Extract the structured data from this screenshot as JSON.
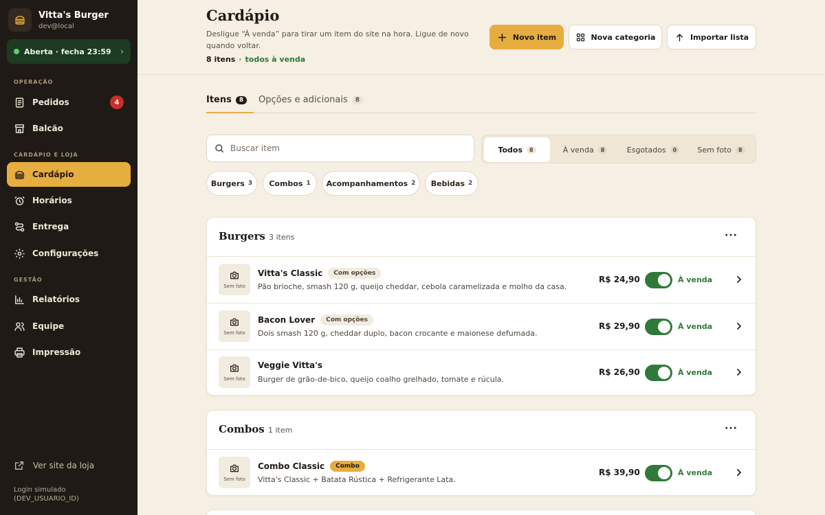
{
  "brand": {
    "name": "Vitta's Burger",
    "user": "dev@local"
  },
  "status": {
    "text": "Aberta · fecha 23:59"
  },
  "nav": {
    "section_operacao": "OPERAÇÃO",
    "section_cardapio": "CARDÁPIO E LOJA",
    "section_gestao": "GESTÃO",
    "pedidos": "Pedidos",
    "pedidos_badge": "4",
    "balcao": "Balcão",
    "cardapio": "Cardápio",
    "horarios": "Horários",
    "entrega": "Entrega",
    "configuracoes": "Configurações",
    "relatorios": "Relatórios",
    "equipe": "Equipe",
    "impressao": "Impressão",
    "ver_site": "Ver site da loja",
    "login_line1": "Login simulado",
    "login_line2": "(DEV_USUARIO_ID)"
  },
  "header": {
    "title": "Cardápio",
    "subtitle": "Desligue “À venda” para tirar um item do site na hora. Ligue de novo quando voltar.",
    "count": "8 itens",
    "separator": "·",
    "count_status": "todos à venda",
    "btn_new": "Novo item",
    "btn_category": "Nova categoria",
    "btn_import": "Importar lista"
  },
  "tabs": {
    "items_label": "Itens",
    "items_count": "8",
    "options_label": "Opções e adicionais",
    "options_count": "8"
  },
  "search": {
    "placeholder": "Buscar item"
  },
  "filters": {
    "all": "Todos",
    "all_count": "8",
    "sale": "À venda",
    "sale_count": "8",
    "sold": "Esgotados",
    "sold_count": "0",
    "nophoto": "Sem foto",
    "nophoto_count": "8"
  },
  "chips": {
    "burgers": "Burgers",
    "burgers_count": "3",
    "combos": "Combos",
    "combos_count": "1",
    "acomp": "Acompanhamentos",
    "acomp_count": "2",
    "bebidas": "Bebidas",
    "bebidas_count": "2"
  },
  "thumb_label": "Sem foto",
  "availability_label": "À venda",
  "sections": [
    {
      "title": "Burgers",
      "count": "3 itens",
      "items": [
        {
          "name": "Vitta's Classic",
          "tag": "Com opções",
          "desc": "Pão brioche, smash 120 g, queijo cheddar, cebola caramelizada e molho da casa.",
          "price": "R$ 24,90"
        },
        {
          "name": "Bacon Lover",
          "tag": "Com opções",
          "desc": "Dois smash 120 g, cheddar duplo, bacon crocante e maionese defumada.",
          "price": "R$ 29,90"
        },
        {
          "name": "Veggie Vitta's",
          "tag": "",
          "desc": "Burger de grão-de-bico, queijo coalho grelhado, tomate e rúcula.",
          "price": "R$ 26,90"
        }
      ]
    },
    {
      "title": "Combos",
      "count": "1 item",
      "items": [
        {
          "name": "Combo Classic",
          "tag": "Combo",
          "desc": "Vitta's Classic + Batata Rústica + Refrigerante Lata.",
          "price": "R$ 39,90"
        }
      ]
    }
  ],
  "colors": {
    "accent": "#e6ad3f",
    "sidebar": "#1f1a15",
    "green": "#2f7a3a",
    "background": "#f6efe3",
    "badge_red": "#c8302a"
  }
}
